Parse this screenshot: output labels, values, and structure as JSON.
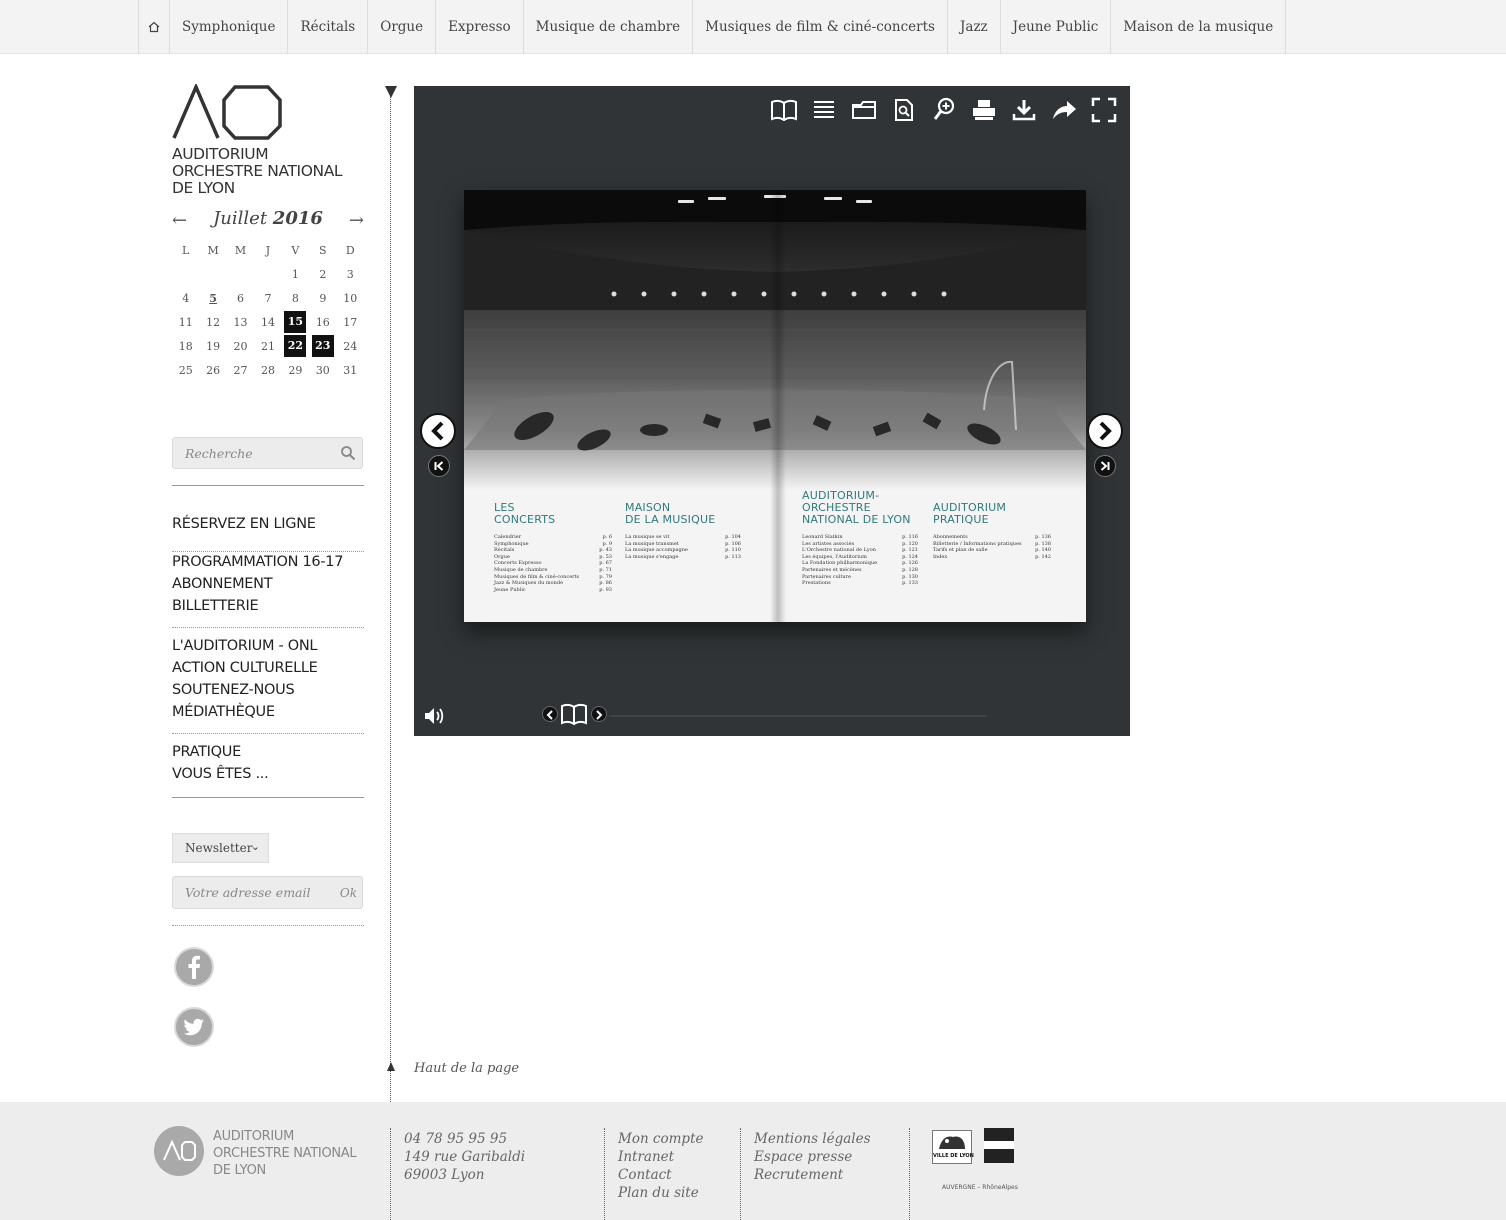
{
  "nav": {
    "home_label": "⌂",
    "items": [
      "Symphonique",
      "Récitals",
      "Orgue",
      "Expresso",
      "Musique de chambre",
      "Musiques de film & ciné-concerts",
      "Jazz",
      "Jeune Public",
      "Maison de la musique"
    ]
  },
  "logo": {
    "line1": "AUDITORIUM",
    "line2": "ORCHESTRE NATIONAL",
    "line3": "DE LYON"
  },
  "calendar": {
    "prev": "←",
    "next": "→",
    "month": "Juillet",
    "year": "2016",
    "weekdays": [
      "L",
      "M",
      "M",
      "J",
      "V",
      "S",
      "D"
    ],
    "weeks": [
      [
        "",
        "",
        "",
        "",
        "1",
        "2",
        "3"
      ],
      [
        "4",
        "5",
        "6",
        "7",
        "8",
        "9",
        "10"
      ],
      [
        "11",
        "12",
        "13",
        "14",
        "15",
        "16",
        "17"
      ],
      [
        "18",
        "19",
        "20",
        "21",
        "22",
        "23",
        "24"
      ],
      [
        "25",
        "26",
        "27",
        "28",
        "29",
        "30",
        "31"
      ]
    ],
    "event_days": [
      "15",
      "22",
      "23"
    ],
    "today": "5"
  },
  "search": {
    "placeholder": "Recherche"
  },
  "menu": {
    "reserve": "RÉSERVEZ EN LIGNE",
    "prog": "PROGRAMMATION 16-17",
    "abo": "ABONNEMENT",
    "billet": "BILLETTERIE",
    "audit": "L'AUDITORIUM - ONL",
    "action": "ACTION CULTURELLE",
    "soutenez": "SOUTENEZ-NOUS",
    "media": "MÉDIATHÈQUE",
    "pratique": "PRATIQUE",
    "vous": "VOUS ÊTES ..."
  },
  "newsletter": {
    "label": "Newsletter",
    "email_placeholder": "Votre adresse email",
    "ok": "Ok"
  },
  "book": {
    "sec1": {
      "title1": "LES",
      "title2": "CONCERTS",
      "rows": [
        [
          "Calendrier",
          "p. 6"
        ],
        [
          "Symphonique",
          "p. 9"
        ],
        [
          "Récitals",
          "p. 43"
        ],
        [
          "Orgue",
          "p. 53"
        ],
        [
          "Concerts Expresso",
          "p. 67"
        ],
        [
          "Musique de chambre",
          "p. 71"
        ],
        [
          "Musiques de film & ciné-concerts",
          "p. 79"
        ],
        [
          "Jazz & Musiques du monde",
          "p. 86"
        ],
        [
          "Jeune Public",
          "p. 93"
        ]
      ]
    },
    "sec2": {
      "title1": "MAISON",
      "title2": "DE LA MUSIQUE",
      "rows": [
        [
          "La musique se vit",
          "p. 104"
        ],
        [
          "La musique transmet",
          "p. 106"
        ],
        [
          "La musique accompagne",
          "p. 110"
        ],
        [
          "La musique s'engage",
          "p. 113"
        ]
      ]
    },
    "sec3": {
      "title1": "AUDITORIUM-",
      "title2": "ORCHESTRE",
      "title3": "NATIONAL DE LYON",
      "rows": [
        [
          "Leonard Slatkin",
          "p. 116"
        ],
        [
          "Les artistes associés",
          "p. 120"
        ],
        [
          "L'Orchestre national de Lyon",
          "p. 121"
        ],
        [
          "Les équipes, l'Auditorium",
          "p. 124"
        ],
        [
          "La Fondation philharmonique",
          "p. 126"
        ],
        [
          "Partenaires et mécènes",
          "p. 128"
        ],
        [
          "Partenaires culture",
          "p. 130"
        ],
        [
          "Prestations",
          "p. 133"
        ]
      ]
    },
    "sec4": {
      "title1": "AUDITORIUM",
      "title2": "PRATIQUE",
      "rows": [
        [
          "Abonnements",
          "p. 136"
        ],
        [
          "Billetterie / Informations pratiques",
          "p. 138"
        ],
        [
          "Tarifs et plan de salle",
          "p. 140"
        ],
        [
          "Index",
          "p. 142"
        ]
      ]
    }
  },
  "backtop": "Haut de la page",
  "footer": {
    "logo1": "AUDITORIUM",
    "logo2": "ORCHESTRE NATIONAL",
    "logo3": "DE LYON",
    "phone": "04 78 95 95 95",
    "street": "149 rue Garibaldi",
    "city": "69003 Lyon",
    "links1": [
      "Mon compte",
      "Intranet",
      "Contact",
      "Plan du site"
    ],
    "links2": [
      "Mentions légales",
      "Espace presse",
      "Recrutement"
    ],
    "partner_lyon": "VILLE DE LYON",
    "partner_region": "AUVERGNE – RhôneAlpes"
  }
}
